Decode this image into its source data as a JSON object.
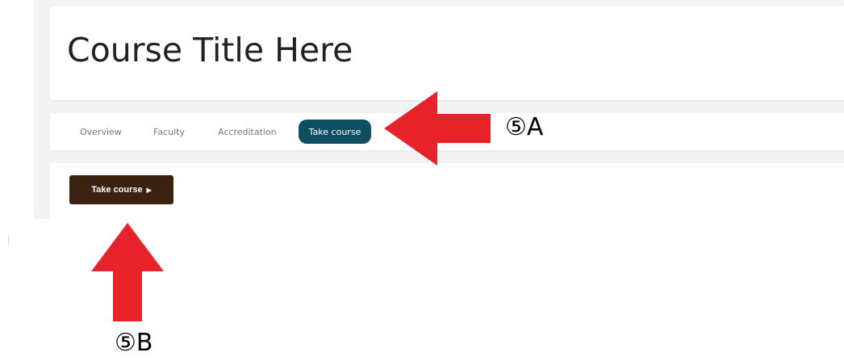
{
  "course": {
    "title": "Course Title Here"
  },
  "tabs": [
    {
      "label": "Overview",
      "active": false
    },
    {
      "label": "Faculty",
      "active": false
    },
    {
      "label": "Accreditation",
      "active": false
    },
    {
      "label": "Take course",
      "active": true
    }
  ],
  "primary_action": {
    "label": "Take course",
    "icon": "caret-right-icon"
  },
  "annotations": {
    "a": {
      "label": "⑤A"
    },
    "b": {
      "label": "⑤B"
    }
  },
  "colors": {
    "active_tab_bg": "#0f4d61",
    "button_bg": "#3a2110",
    "annotation_arrow": "#e8222a"
  }
}
